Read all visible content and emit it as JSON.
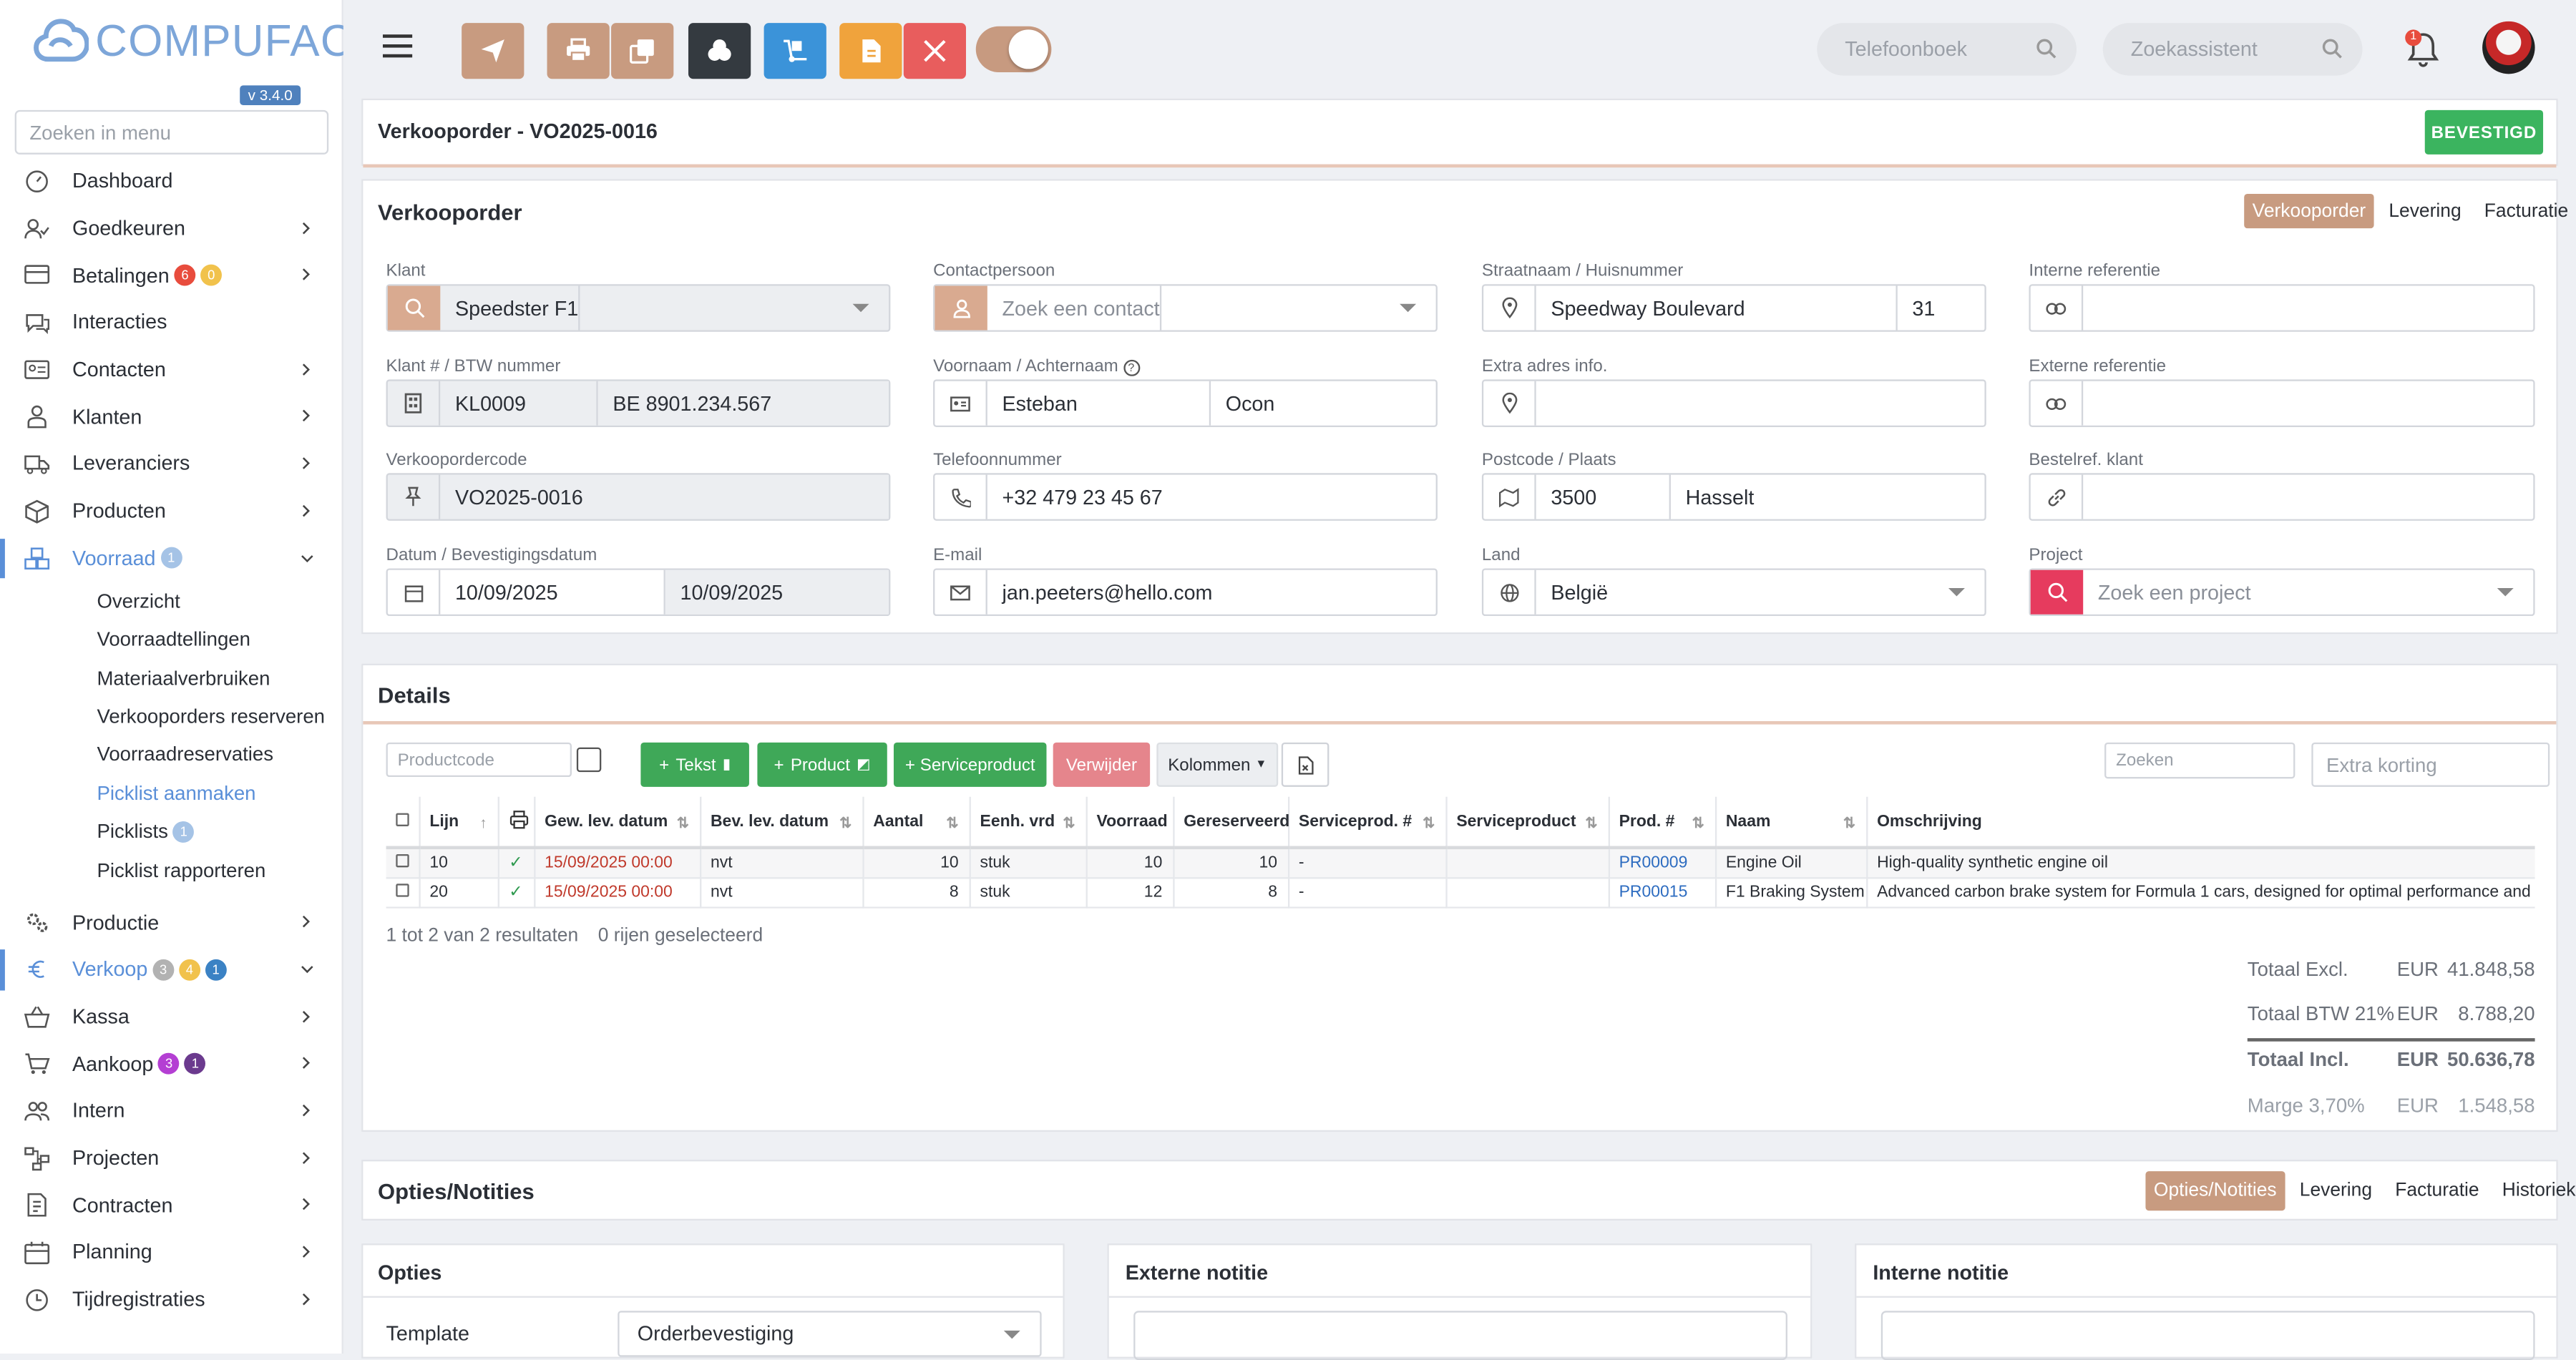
{
  "app": {
    "logo_text": "COMPUFACT",
    "version": "v 3.4.0",
    "menu_search_placeholder": "Zoeken in menu"
  },
  "sidebar": {
    "items": [
      {
        "label": "Dashboard",
        "icon": "dashboard-icon",
        "chevron": false
      },
      {
        "label": "Goedkeuren",
        "icon": "user-check-icon",
        "chevron": true
      },
      {
        "label": "Betalingen",
        "icon": "credit-card-icon",
        "chevron": true,
        "badges": [
          {
            "text": "6",
            "color": "#e84c3d"
          },
          {
            "text": "0",
            "color": "#f1c24c"
          }
        ]
      },
      {
        "label": "Interacties",
        "icon": "chat-icon",
        "chevron": false
      },
      {
        "label": "Contacten",
        "icon": "contact-card-icon",
        "chevron": true
      },
      {
        "label": "Klanten",
        "icon": "customer-icon",
        "chevron": true
      },
      {
        "label": "Leveranciers",
        "icon": "truck-icon",
        "chevron": true
      },
      {
        "label": "Producten",
        "icon": "box-icon",
        "chevron": true
      },
      {
        "label": "Voorraad",
        "icon": "boxes-icon",
        "chevron": true,
        "expanded": true,
        "active": true,
        "badges": [
          {
            "text": "1",
            "color": "#a5c3e6"
          }
        ]
      }
    ],
    "voorraad_sub": [
      {
        "label": "Overzicht"
      },
      {
        "label": "Voorraadtellingen"
      },
      {
        "label": "Materiaalverbruiken"
      },
      {
        "label": "Verkooporders reserveren"
      },
      {
        "label": "Voorraadreservaties"
      },
      {
        "label": "Picklist aanmaken",
        "active": true
      },
      {
        "label": "Picklists",
        "badge": "1"
      },
      {
        "label": "Picklist rapporteren"
      }
    ],
    "items2": [
      {
        "label": "Productie",
        "icon": "gears-icon",
        "chevron": true
      },
      {
        "label": "Verkoop",
        "icon": "euro-icon",
        "chevron": true,
        "expanded": true,
        "active": true,
        "badges": [
          {
            "text": "3",
            "color": "#b2b2b2"
          },
          {
            "text": "4",
            "color": "#f1c24c"
          },
          {
            "text": "1",
            "color": "#3b82c4"
          }
        ]
      },
      {
        "label": "Kassa",
        "icon": "basket-icon",
        "chevron": true
      },
      {
        "label": "Aankoop",
        "icon": "cart-icon",
        "chevron": true,
        "badges": [
          {
            "text": "3",
            "color": "#b43fd3"
          },
          {
            "text": "1",
            "color": "#6b3a8e"
          }
        ]
      },
      {
        "label": "Intern",
        "icon": "users-icon",
        "chevron": true
      },
      {
        "label": "Projecten",
        "icon": "project-icon",
        "chevron": true
      },
      {
        "label": "Contracten",
        "icon": "contract-icon",
        "chevron": true
      },
      {
        "label": "Planning",
        "icon": "calendar-icon",
        "chevron": true
      },
      {
        "label": "Tijdregistraties",
        "icon": "clock-icon",
        "chevron": true
      }
    ]
  },
  "topbar": {
    "buttons": [
      {
        "name": "send-button",
        "icon": "paper-plane-icon",
        "color": "#c89b80"
      },
      {
        "name": "print-button",
        "icon": "printer-icon",
        "color": "#c89b80"
      },
      {
        "name": "copy-button",
        "icon": "copy-icon",
        "color": "#c89b80"
      },
      {
        "name": "related-button",
        "icon": "boxes-icon",
        "color": "#343a40"
      },
      {
        "name": "delivery-button",
        "icon": "dolly-icon",
        "color": "#3b93d9"
      },
      {
        "name": "document-button",
        "icon": "file-icon",
        "color": "#f0a33c"
      },
      {
        "name": "close-button",
        "icon": "close-icon",
        "color": "#e85d5d"
      }
    ],
    "phonebook_placeholder": "Telefoonboek",
    "assistant_placeholder": "Zoekassistent",
    "notification_count": "1"
  },
  "header": {
    "title": "Verkooporder - VO2025-0016",
    "status": "BEVESTIGD"
  },
  "order": {
    "title": "Verkooporder",
    "tabs": [
      "Verkooporder",
      "Levering",
      "Facturatie"
    ],
    "klant_label": "Klant",
    "klant_value": "Speedster F1",
    "klantnr_label": "Klant # / BTW nummer",
    "klantnr_value": "KL0009",
    "btw_value": "BE 8901.234.567",
    "code_label": "Verkoopordercode",
    "code_value": "VO2025-0016",
    "datum_label": "Datum / Bevestigingsdatum",
    "datum_value": "10/09/2025",
    "bevestiging_value": "10/09/2025",
    "contact_label": "Contactpersoon",
    "contact_placeholder": "Zoek een contact",
    "naam_label": "Voornaam / Achternaam",
    "voornaam_value": "Esteban",
    "achternaam_value": "Ocon",
    "tel_label": "Telefoonnummer",
    "tel_value": "+32 479 23 45 67",
    "email_label": "E-mail",
    "email_value": "jan.peeters@hello.com",
    "straat_label": "Straatnaam / Huisnummer",
    "straat_value": "Speedway Boulevard",
    "huisnr_value": "31",
    "extra_label": "Extra adres info.",
    "extra_value": "",
    "postcode_label": "Postcode / Plaats",
    "postcode_value": "3500",
    "plaats_value": "Hasselt",
    "land_label": "Land",
    "land_value": "België",
    "intref_label": "Interne referentie",
    "intref_value": "",
    "extref_label": "Externe referentie",
    "extref_value": "",
    "bestelref_label": "Bestelref. klant",
    "bestelref_value": "",
    "project_label": "Project",
    "project_placeholder": "Zoek een project"
  },
  "details": {
    "title": "Details",
    "productcode_placeholder": "Productcode",
    "btn_tekst": "Tekst",
    "btn_product": "Product",
    "btn_service": "Serviceproduct",
    "btn_verwijder": "Verwijder",
    "btn_kolommen": "Kolommen",
    "search_placeholder": "Zoeken",
    "korting_placeholder": "Extra korting",
    "columns": [
      "Lijn",
      "",
      "Gew. lev. datum",
      "Bev. lev. datum",
      "Aantal",
      "Eenh. vrd",
      "Voorraad",
      "Gereserveerd",
      "Serviceprod. #",
      "Serviceproduct",
      "Prod. #",
      "Naam",
      "Omschrijving"
    ],
    "rows": [
      {
        "lijn": "10",
        "gew": "15/09/2025 00:00",
        "bev": "nvt",
        "aantal": "10",
        "eenh": "stuk",
        "voorraad": "10",
        "gereserveerd": "10",
        "servnr": "-",
        "serv": "",
        "prod": "PR00009",
        "naam": "Engine Oil",
        "omschrijving": "High-quality synthetic engine oil"
      },
      {
        "lijn": "20",
        "gew": "15/09/2025 00:00",
        "bev": "nvt",
        "aantal": "8",
        "eenh": "stuk",
        "voorraad": "12",
        "gereserveerd": "8",
        "servnr": "-",
        "serv": "",
        "prod": "PR00015",
        "naam": "F1 Braking System",
        "omschrijving": "Advanced carbon brake system for Formula 1 cars, designed for optimal performance and heat"
      }
    ],
    "result_text": "1 tot 2 van 2 resultaten",
    "selected_text": "0 rijen geselecteerd",
    "totals": [
      {
        "label": "Totaal Excl.",
        "cur": "EUR",
        "value": "41.848,58"
      },
      {
        "label": "Totaal BTW 21%",
        "cur": "EUR",
        "value": "8.788,20"
      },
      {
        "label": "Totaal Incl.",
        "cur": "EUR",
        "value": "50.636,78"
      },
      {
        "label": "Marge 3,70%",
        "cur": "EUR",
        "value": "1.548,58"
      }
    ]
  },
  "options": {
    "title": "Opties/Notities",
    "tabs": [
      "Opties/Notities",
      "Levering",
      "Facturatie",
      "Historiek"
    ],
    "opties_title": "Opties",
    "extern_title": "Externe notitie",
    "intern_title": "Interne notitie",
    "template_label": "Template",
    "template_value": "Orderbevestiging"
  }
}
